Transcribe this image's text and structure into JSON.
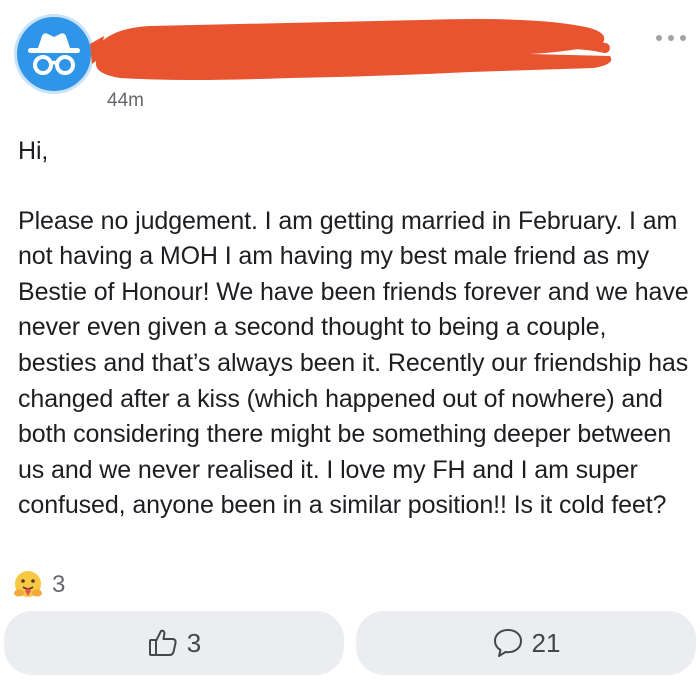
{
  "post": {
    "author_name": "",
    "timestamp": "44m",
    "greeting": "Hi,",
    "body": "Please no judgement.  I am getting married in February.  I am not having a MOH I am having my best male friend as my Bestie of Honour! We have been friends forever and we have never even given a second thought to being a couple, besties and that’s always been it.  Recently our friendship has changed after a kiss (which happened out of nowhere) and both considering there might be something deeper between us and we never realised it.  I love my FH and I am super confused, anyone been in a similar position!! Is it cold feet?",
    "reaction_icon": "care-hug-emoji-icon",
    "reaction_count": "3"
  },
  "actions": {
    "like_count": "3",
    "like_icon": "thumbs-up-icon",
    "comment_count": "21",
    "comment_icon": "comment-bubble-icon"
  },
  "colors": {
    "avatar_bg": "#2f95e8",
    "redaction": "#e8542f",
    "action_button_bg": "#ebedf0",
    "secondary_text": "#65676b"
  }
}
